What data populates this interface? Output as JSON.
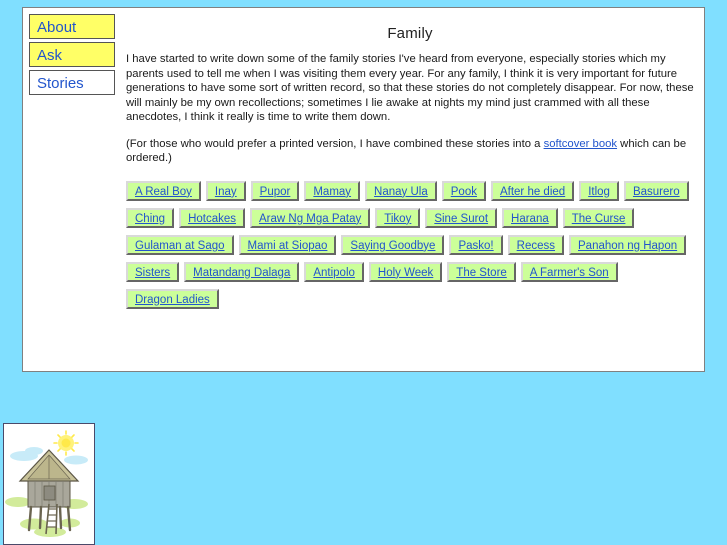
{
  "page": {
    "background_color": "#80DFFF",
    "panel_background": "#ffffff",
    "title": "Family"
  },
  "nav": {
    "items": [
      {
        "label": "About",
        "state": "yellow",
        "color": "#FFFF66"
      },
      {
        "label": "Ask",
        "state": "yellow",
        "color": "#FFFF66"
      },
      {
        "label": "Stories",
        "state": "white",
        "color": "#ffffff"
      }
    ]
  },
  "article": {
    "paragraph_1": "I have started to write down some of the family stories I've heard from everyone, especially stories which my parents used to tell me when I was visiting them every year. For any family, I think it is very important for future generations to have some sort of written record, so that these stories do not completely disappear. For now, these will mainly be my own recollections; sometimes I lie awake at nights my mind just crammed with all these anecdotes, I think it really is time to write them down.",
    "paragraph_2_before_link": "(For those who would prefer a printed version, I have combined these stories into a ",
    "link_text": "softcover book",
    "paragraph_2_after_link": " which can be ordered.)",
    "link_color": "#2255cc"
  },
  "stories": {
    "chip_background": "#CCFF99",
    "chip_text_color": "#2255cc",
    "items": [
      "A Real Boy",
      "Inay",
      "Pupor",
      "Mamay",
      "Nanay Ula",
      "Pook",
      "After he died",
      "Itlog",
      "Basurero",
      "Ching",
      "Hotcakes",
      "Araw Ng Mga Patay",
      "Tikoy",
      "Sine Surot",
      "Harana",
      "The Curse",
      "Gulaman at Sago",
      "Mami at Siopao",
      "Saying Goodbye",
      "Pasko!",
      "Recess",
      "Panahon ng Hapon",
      "Sisters",
      "Matandang Dalaga",
      "Antipolo",
      "Holy Week",
      "The Store",
      "A Farmer's Son",
      "Dragon Ladies"
    ]
  },
  "figure": {
    "name": "nipa-hut-illustration",
    "alt": "Sketch of a nipa hut on stilts with ladder, sun, clouds and grass"
  }
}
